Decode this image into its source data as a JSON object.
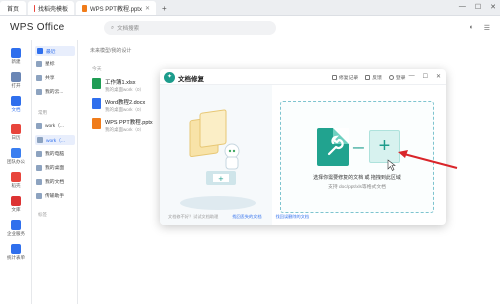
{
  "tabs": {
    "home": "首页",
    "tab1": "找稻壳模板",
    "tab2": "WPS PPT教程.pptx",
    "new_tab": "+"
  },
  "header": {
    "logo": "WPS Office",
    "search_placeholder": "文档搜索"
  },
  "rail": {
    "items": [
      "新建",
      "打开",
      "文档",
      "日历",
      "团队办公",
      "稻壳",
      "文库",
      "企业服务",
      "统计表单"
    ]
  },
  "col2": {
    "items": [
      "最近",
      "星标",
      "共享",
      "我的云..."
    ],
    "section_label": "常用",
    "locations": [
      "work（...",
      "work（...",
      "我的电脑",
      "我的桌面",
      "我的文档",
      "传输助手"
    ],
    "more_label": "标签"
  },
  "main": {
    "crumb": "未来模型/我的设计",
    "today": "今天",
    "files": [
      {
        "name": "工作簿1.xlsx",
        "path": "我的桌面work（0）"
      },
      {
        "name": "Word教程2.docx",
        "path": "我的桌面work（0）"
      },
      {
        "name": "WPS PPT教程.pptx",
        "path": "我的桌面work（0）"
      }
    ]
  },
  "modal": {
    "title": "文档修复",
    "actions": [
      "修复记录",
      "反馈",
      "登录"
    ],
    "dz_line1": "选择你需要修复的文档 或 拖拽到此区域",
    "dz_line2": "支持 doc/ppt/xls等格式文档",
    "footer_tip": "文档修不好？试试文档助理",
    "footer_link1": "找回丢失的文档",
    "footer_link2": "找回误删除的文档"
  },
  "colors": {
    "accent": "#1c9c8c",
    "arrow": "#d9252a",
    "link": "#2f6fed"
  }
}
